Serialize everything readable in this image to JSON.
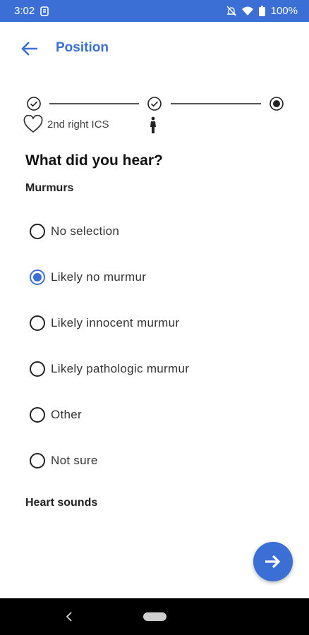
{
  "status_bar": {
    "time": "3:02",
    "battery": "100%",
    "icons": [
      "sim-icon",
      "bell-off-icon",
      "wifi-icon",
      "battery-icon"
    ]
  },
  "app_bar": {
    "title": "Position",
    "back_icon": "arrow-left-icon"
  },
  "stepper": {
    "steps": [
      {
        "state": "complete",
        "icon": "check-circle-icon"
      },
      {
        "state": "complete",
        "icon": "check-circle-icon"
      },
      {
        "state": "current",
        "icon": "radio-checked-icon"
      }
    ],
    "position_label": "2nd right ICS",
    "heart_icon": "heart-icon",
    "body_icon": "person-icon"
  },
  "question": "What did you hear?",
  "murmurs": {
    "title": "Murmurs",
    "selected_index": 1,
    "options": [
      "No selection",
      "Likely no murmur",
      "Likely innocent murmur",
      "Likely pathologic murmur",
      "Other",
      "Not sure"
    ]
  },
  "heart_sounds": {
    "title": "Heart sounds"
  },
  "fab": {
    "icon": "arrow-right-icon"
  },
  "nav_bar": {
    "back_icon": "chevron-left-icon",
    "home_icon": "home-pill-icon"
  },
  "colors": {
    "primary": "#3b6fd6",
    "nav_background": "#000000"
  }
}
